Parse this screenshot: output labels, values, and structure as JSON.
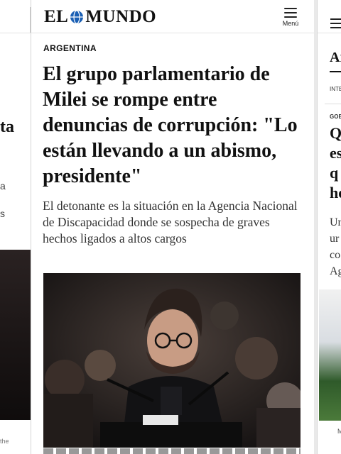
{
  "left_card": {
    "fragment_ta": "ta",
    "fragment_a": "a",
    "fragment_s": "s",
    "credit_fragment": "the"
  },
  "header": {
    "logo_left": "EL",
    "logo_right": "MUNDO",
    "menu_label": "Menú",
    "logo_icon": "globe-icon",
    "menu_icon": "hamburger-icon"
  },
  "article": {
    "section": "ARGENTINA",
    "headline": "El grupo parlamentario de Milei se rompe entre denuncias de corrupción: \"Lo están llevando a un abismo, presidente\"",
    "standfirst": "El detonante es la situación en la Agencia Nacional de Discapacidad donde se sospecha de graves hechos ligados a altos cargos"
  },
  "right_card": {
    "section_fragment": "Ar",
    "tag_fragment": "INTE",
    "kicker_fragment": "GOE",
    "headline_lines": [
      "Q",
      "es",
      "q",
      "he"
    ],
    "standfirst_lines": [
      "Ur",
      "ur",
      "co",
      "Ag"
    ],
    "credit_fragment": "M"
  },
  "colors": {
    "brand_blue": "#1a5fb4",
    "text": "#111111"
  }
}
